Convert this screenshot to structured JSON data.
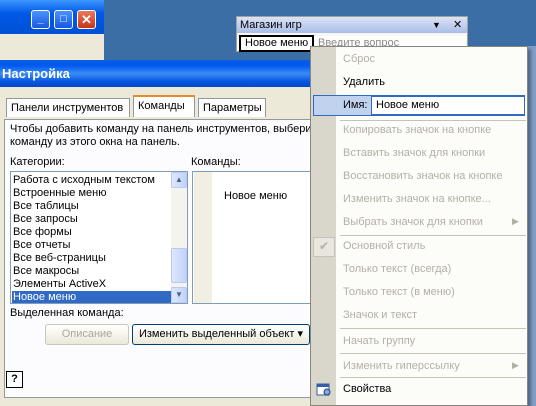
{
  "top_window": {
    "minimize_glyph": "_",
    "maximize_glyph": "□",
    "close_glyph": "✕"
  },
  "dialog": {
    "title": "Настройка",
    "tabs": [
      "Панели инструментов",
      "Команды",
      "Параметры"
    ],
    "active_tab": "Команды",
    "instruction_line1": "Чтобы добавить команду на панель инструментов, выбери",
    "instruction_line2": "команду из этого окна на панель.",
    "categories_label": "Категории:",
    "commands_label": "Команды:",
    "categories": [
      "Работа с исходным текстом",
      "Встроенные меню",
      "Все таблицы",
      "Все запросы",
      "Все формы",
      "Все отчеты",
      "Все веб-страницы",
      "Все макросы",
      "Элементы ActiveX",
      "Новое меню"
    ],
    "selected_category": "Новое меню",
    "commands": [
      "Новое меню"
    ],
    "selected_command_label": "Выделенная команда:",
    "description_button": "Описание",
    "modify_selection_button": "Изменить выделенный объект",
    "help_glyph": "?"
  },
  "toolbar": {
    "title": "Магазин игр",
    "menu_item": "Новое меню",
    "ask_placeholder": "Введите вопрос"
  },
  "context_menu": {
    "reset": "Сброс",
    "delete": "Удалить",
    "name_label": "Имя:",
    "name_value": "Новое меню",
    "copy_icon": "Копировать значок на кнопке",
    "paste_icon": "Вставить значок для кнопки",
    "restore_icon": "Восстановить значок на кнопке",
    "edit_icon": "Изменить значок на кнопке...",
    "choose_icon": "Выбрать значок для кнопки",
    "default_style": "Основной стиль",
    "text_only_always": "Только текст (всегда)",
    "text_only_menu": "Только текст (в меню)",
    "icon_and_text": "Значок и текст",
    "begin_group": "Начать группу",
    "edit_hyperlink": "Изменить гиперссылку",
    "properties": "Свойства"
  }
}
